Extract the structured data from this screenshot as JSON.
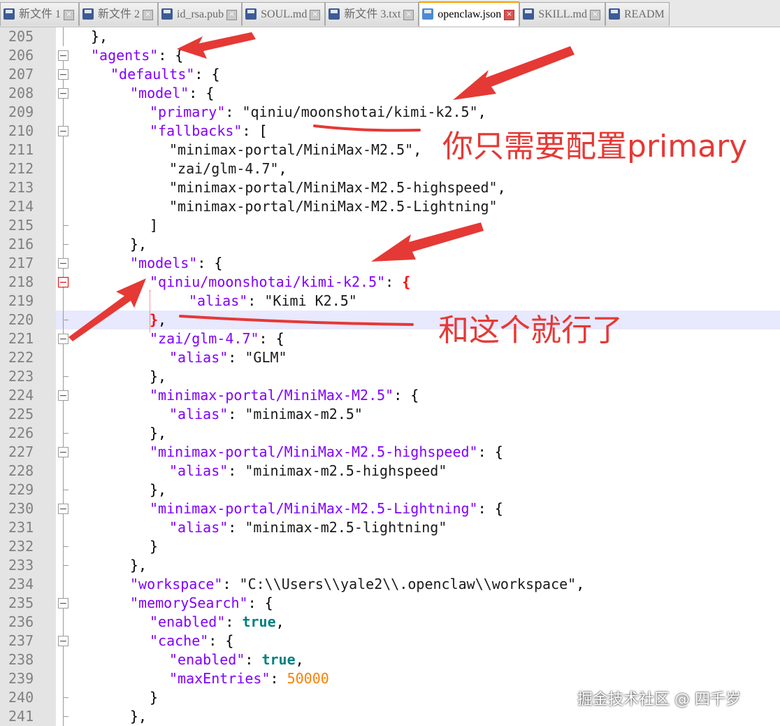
{
  "tabs": [
    {
      "label": "新文件 1",
      "active": false
    },
    {
      "label": "新文件 2",
      "active": false
    },
    {
      "label": "id_rsa.pub",
      "active": false
    },
    {
      "label": "SOUL.md",
      "active": false
    },
    {
      "label": "新文件 3.txt",
      "active": false
    },
    {
      "label": "openclaw.json",
      "active": true
    },
    {
      "label": "SKILL.md",
      "active": false
    },
    {
      "label": "READM",
      "active": false
    }
  ],
  "close_glyph": "×",
  "lines": [
    {
      "n": "205",
      "fold": "line",
      "indent": 1,
      "tokens": [
        [
          "p",
          "},"
        ]
      ]
    },
    {
      "n": "206",
      "fold": "box",
      "indent": 1,
      "tokens": [
        [
          "k",
          "\"agents\""
        ],
        [
          "p",
          ": {"
        ]
      ]
    },
    {
      "n": "207",
      "fold": "box",
      "indent": 2,
      "tokens": [
        [
          "k",
          "\"defaults\""
        ],
        [
          "p",
          ": {"
        ]
      ]
    },
    {
      "n": "208",
      "fold": "box",
      "indent": 3,
      "tokens": [
        [
          "k",
          "\"model\""
        ],
        [
          "p",
          ": {"
        ]
      ]
    },
    {
      "n": "209",
      "fold": "line",
      "indent": 4,
      "tokens": [
        [
          "k",
          "\"primary\""
        ],
        [
          "p",
          ": "
        ],
        [
          "s",
          "\"qiniu/moonshotai/kimi-k2.5\""
        ],
        [
          "p",
          ","
        ]
      ]
    },
    {
      "n": "210",
      "fold": "box",
      "indent": 4,
      "tokens": [
        [
          "k",
          "\"fallbacks\""
        ],
        [
          "p",
          ": ["
        ]
      ]
    },
    {
      "n": "211",
      "fold": "line",
      "indent": 5,
      "tokens": [
        [
          "s",
          "\"minimax-portal/MiniMax-M2.5\""
        ],
        [
          "p",
          ","
        ]
      ]
    },
    {
      "n": "212",
      "fold": "line",
      "indent": 5,
      "tokens": [
        [
          "s",
          "\"zai/glm-4.7\""
        ],
        [
          "p",
          ","
        ]
      ]
    },
    {
      "n": "213",
      "fold": "line",
      "indent": 5,
      "tokens": [
        [
          "s",
          "\"minimax-portal/MiniMax-M2.5-highspeed\""
        ],
        [
          "p",
          ","
        ]
      ]
    },
    {
      "n": "214",
      "fold": "line",
      "indent": 5,
      "tokens": [
        [
          "s",
          "\"minimax-portal/MiniMax-M2.5-Lightning\""
        ]
      ]
    },
    {
      "n": "215",
      "fold": "tail",
      "indent": 4,
      "tokens": [
        [
          "p",
          "]"
        ]
      ]
    },
    {
      "n": "216",
      "fold": "tail",
      "indent": 3,
      "tokens": [
        [
          "p",
          "},"
        ]
      ]
    },
    {
      "n": "217",
      "fold": "box",
      "indent": 3,
      "tokens": [
        [
          "k",
          "\"models\""
        ],
        [
          "p",
          ": {"
        ]
      ]
    },
    {
      "n": "218",
      "fold": "box-red",
      "indent": 4,
      "tokens": [
        [
          "k",
          "\"qiniu/moonshotai/kimi-k2.5\""
        ],
        [
          "p",
          ": "
        ],
        [
          "rb",
          "{"
        ]
      ]
    },
    {
      "n": "219",
      "fold": "line",
      "indent": 6,
      "tokens": [
        [
          "k",
          "\"alias\""
        ],
        [
          "p",
          ": "
        ],
        [
          "s",
          "\"Kimi K2.5\""
        ]
      ]
    },
    {
      "n": "220",
      "fold": "tail",
      "indent": 4,
      "highlight": true,
      "tokens": [
        [
          "rb",
          "}"
        ],
        [
          "p",
          ","
        ]
      ]
    },
    {
      "n": "221",
      "fold": "box",
      "indent": 4,
      "tokens": [
        [
          "k",
          "\"zai/glm-4.7\""
        ],
        [
          "p",
          ": {"
        ]
      ]
    },
    {
      "n": "222",
      "fold": "line",
      "indent": 5,
      "tokens": [
        [
          "k",
          "\"alias\""
        ],
        [
          "p",
          ": "
        ],
        [
          "s",
          "\"GLM\""
        ]
      ]
    },
    {
      "n": "223",
      "fold": "tail",
      "indent": 4,
      "tokens": [
        [
          "p",
          "},"
        ]
      ]
    },
    {
      "n": "224",
      "fold": "box",
      "indent": 4,
      "tokens": [
        [
          "k",
          "\"minimax-portal/MiniMax-M2.5\""
        ],
        [
          "p",
          ": {"
        ]
      ]
    },
    {
      "n": "225",
      "fold": "line",
      "indent": 5,
      "tokens": [
        [
          "k",
          "\"alias\""
        ],
        [
          "p",
          ": "
        ],
        [
          "s",
          "\"minimax-m2.5\""
        ]
      ]
    },
    {
      "n": "226",
      "fold": "tail",
      "indent": 4,
      "tokens": [
        [
          "p",
          "},"
        ]
      ]
    },
    {
      "n": "227",
      "fold": "box",
      "indent": 4,
      "tokens": [
        [
          "k",
          "\"minimax-portal/MiniMax-M2.5-highspeed\""
        ],
        [
          "p",
          ": {"
        ]
      ]
    },
    {
      "n": "228",
      "fold": "line",
      "indent": 5,
      "tokens": [
        [
          "k",
          "\"alias\""
        ],
        [
          "p",
          ": "
        ],
        [
          "s",
          "\"minimax-m2.5-highspeed\""
        ]
      ]
    },
    {
      "n": "229",
      "fold": "tail",
      "indent": 4,
      "tokens": [
        [
          "p",
          "},"
        ]
      ]
    },
    {
      "n": "230",
      "fold": "box",
      "indent": 4,
      "tokens": [
        [
          "k",
          "\"minimax-portal/MiniMax-M2.5-Lightning\""
        ],
        [
          "p",
          ": {"
        ]
      ]
    },
    {
      "n": "231",
      "fold": "line",
      "indent": 5,
      "tokens": [
        [
          "k",
          "\"alias\""
        ],
        [
          "p",
          ": "
        ],
        [
          "s",
          "\"minimax-m2.5-lightning\""
        ]
      ]
    },
    {
      "n": "232",
      "fold": "tail",
      "indent": 4,
      "tokens": [
        [
          "p",
          "}"
        ]
      ]
    },
    {
      "n": "233",
      "fold": "tail",
      "indent": 3,
      "tokens": [
        [
          "p",
          "},"
        ]
      ]
    },
    {
      "n": "234",
      "fold": "line",
      "indent": 3,
      "tokens": [
        [
          "k",
          "\"workspace\""
        ],
        [
          "p",
          ": "
        ],
        [
          "s",
          "\"C:\\\\Users\\\\yale2\\\\.openclaw\\\\workspace\""
        ],
        [
          "p",
          ","
        ]
      ]
    },
    {
      "n": "235",
      "fold": "box",
      "indent": 3,
      "tokens": [
        [
          "k",
          "\"memorySearch\""
        ],
        [
          "p",
          ": {"
        ]
      ]
    },
    {
      "n": "236",
      "fold": "line",
      "indent": 4,
      "tokens": [
        [
          "k",
          "\"enabled\""
        ],
        [
          "p",
          ": "
        ],
        [
          "b",
          "true"
        ],
        [
          "p",
          ","
        ]
      ]
    },
    {
      "n": "237",
      "fold": "box",
      "indent": 4,
      "tokens": [
        [
          "k",
          "\"cache\""
        ],
        [
          "p",
          ": {"
        ]
      ]
    },
    {
      "n": "238",
      "fold": "line",
      "indent": 5,
      "tokens": [
        [
          "k",
          "\"enabled\""
        ],
        [
          "p",
          ": "
        ],
        [
          "b",
          "true"
        ],
        [
          "p",
          ","
        ]
      ]
    },
    {
      "n": "239",
      "fold": "line",
      "indent": 5,
      "tokens": [
        [
          "k",
          "\"maxEntries\""
        ],
        [
          "p",
          ": "
        ],
        [
          "n",
          "50000"
        ]
      ]
    },
    {
      "n": "240",
      "fold": "tail",
      "indent": 4,
      "tokens": [
        [
          "p",
          "}"
        ]
      ]
    },
    {
      "n": "241",
      "fold": "tail",
      "indent": 3,
      "tokens": [
        [
          "p",
          "},"
        ]
      ]
    }
  ],
  "annotations": {
    "note_primary": "你只需要配置primary",
    "note_models": "和这个就行了"
  },
  "watermark": "掘金技术社区 @ 四千岁",
  "colors": {
    "key": "#8000ff",
    "string": "#1a1a1a",
    "boolean": "#008080",
    "number": "#ff8000",
    "annotation": "#e53935"
  }
}
